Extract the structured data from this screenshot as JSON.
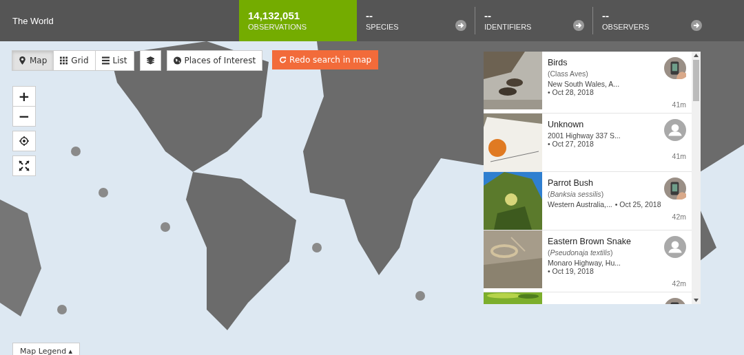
{
  "header": {
    "title": "The World"
  },
  "stats": [
    {
      "value": "14,132,051",
      "label": "OBSERVATIONS",
      "selected": true
    },
    {
      "value": "--",
      "label": "SPECIES",
      "selected": false
    },
    {
      "value": "--",
      "label": "IDENTIFIERS",
      "selected": false
    },
    {
      "value": "--",
      "label": "OBSERVERS",
      "selected": false
    }
  ],
  "view_tabs": [
    {
      "label": "Map",
      "selected": true
    },
    {
      "label": "Grid",
      "selected": false
    },
    {
      "label": "List",
      "selected": false
    }
  ],
  "places_button": "Places of Interest",
  "redo_button": "Redo search in map",
  "zoom_in": "+",
  "zoom_out": "−",
  "map_legend": "Map Legend ▴",
  "observations": [
    {
      "kind": "photo_avatar",
      "name": "Birds",
      "taxon": "(Class Aves)",
      "place": "New South Wales, A...",
      "date": "• Oct 28, 2018",
      "time": "41m"
    },
    {
      "kind": "default_avatar",
      "name": "Unknown",
      "place": "2001 Highway 337 S...",
      "date": "• Oct 27, 2018",
      "time": "41m"
    },
    {
      "kind": "photo_avatar",
      "name": "Parrot Bush",
      "taxon": "(*Banksia sessilis*)",
      "place": "Western Australia,...",
      "date": "• Oct 25, 2018",
      "time": "42m"
    },
    {
      "kind": "default_avatar",
      "name": "Eastern Brown Snake",
      "taxon": "(*Pseudonaja textilis*)",
      "place": "Monaro Highway, Hu...",
      "date": "• Oct 19, 2018",
      "time": "42m"
    },
    {
      "kind": "photo_avatar"
    }
  ]
}
